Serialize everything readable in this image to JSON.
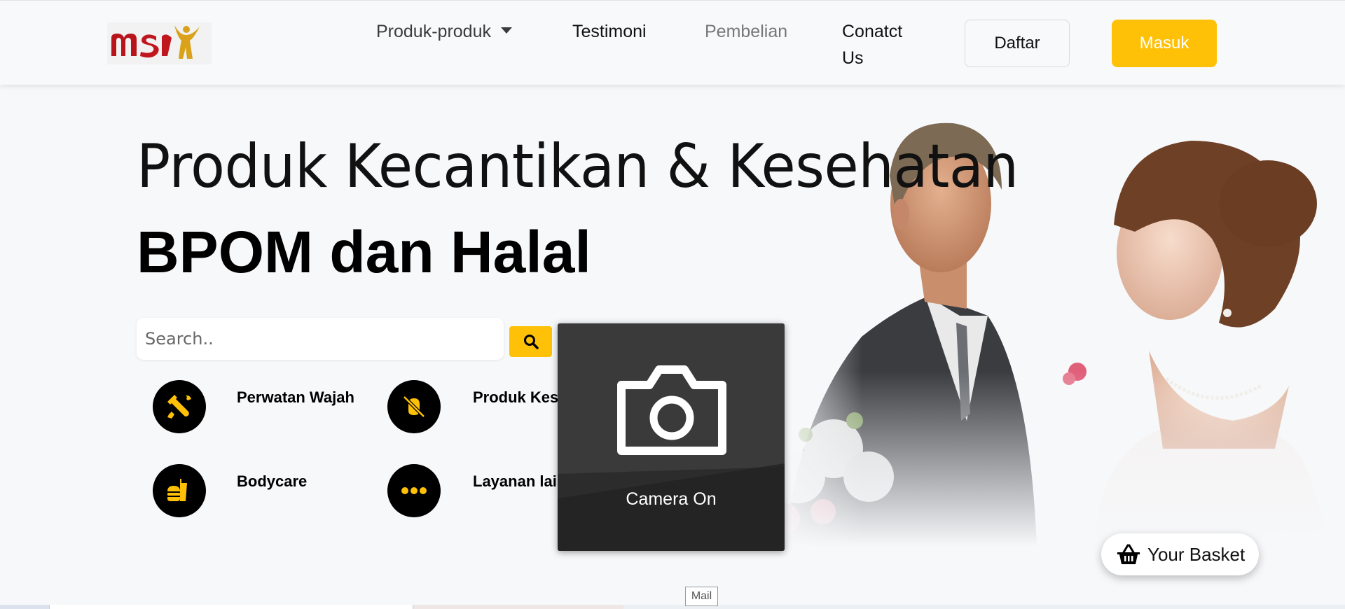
{
  "nav": {
    "logo_text": "msi",
    "items": [
      {
        "label": "Produk-produk"
      },
      {
        "label": "Testimoni"
      },
      {
        "label": "Pembelian"
      },
      {
        "label": "Conatct Us"
      }
    ],
    "register_label": "Daftar",
    "login_label": "Masuk"
  },
  "hero": {
    "headline": "Produk Kecantikan & Kesehatan",
    "subheadline": "BPOM dan Halal"
  },
  "search": {
    "placeholder": "Search..",
    "button_icon": "search-icon"
  },
  "categories": [
    {
      "label": "Perwatan Wajah",
      "icon": "tools-icon"
    },
    {
      "label": "Produk Kesehatan",
      "icon": "bug-slash-icon"
    },
    {
      "label": "Bodycare",
      "icon": "food-icon"
    },
    {
      "label": "Layanan lainnya",
      "icon": "ellipsis-icon"
    }
  ],
  "camera_overlay": {
    "label": "Camera On",
    "icon": "camera-icon"
  },
  "basket": {
    "label": "Your Basket",
    "icon": "basket-icon"
  },
  "tooltip": {
    "label": "Mail"
  },
  "colors": {
    "accent": "#ffc107",
    "nav_bg": "#f8f9fa",
    "page_bg": "#f7f8fa",
    "logo_red": "#c0161e",
    "logo_gold": "#d9a21a"
  }
}
